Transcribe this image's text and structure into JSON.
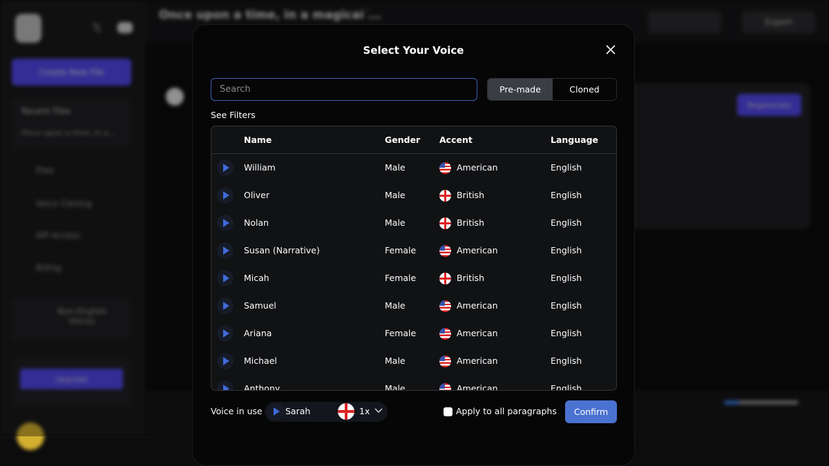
{
  "background": {
    "doc_title": "Once upon a time, in a magical ...",
    "create_new_file": "Create New File",
    "recent_files": "Recent Files",
    "recent_item": "Once upon a time, in a...",
    "nav": [
      "Files",
      "Voice Cloning",
      "API Access",
      "Billing"
    ],
    "non_english": "Non-English Voices",
    "upgrade": "Upgrade",
    "export": "Export",
    "regenerate": "Regenerate"
  },
  "modal": {
    "title": "Select Your Voice",
    "search_placeholder": "Search",
    "tabs": [
      {
        "label": "Pre-made",
        "active": true
      },
      {
        "label": "Cloned",
        "active": false
      }
    ],
    "see_filters": "See Filters",
    "columns": {
      "name": "Name",
      "gender": "Gender",
      "accent": "Accent",
      "language": "Language"
    },
    "voices": [
      {
        "name": "William",
        "gender": "Male",
        "accent": "American",
        "flag": "us",
        "language": "English"
      },
      {
        "name": "Oliver",
        "gender": "Male",
        "accent": "British",
        "flag": "uk",
        "language": "English"
      },
      {
        "name": "Nolan",
        "gender": "Male",
        "accent": "British",
        "flag": "uk",
        "language": "English"
      },
      {
        "name": "Susan (Narrative)",
        "gender": "Female",
        "accent": "American",
        "flag": "us",
        "language": "English"
      },
      {
        "name": "Micah",
        "gender": "Female",
        "accent": "British",
        "flag": "uk",
        "language": "English"
      },
      {
        "name": "Samuel",
        "gender": "Male",
        "accent": "American",
        "flag": "us",
        "language": "English"
      },
      {
        "name": "Ariana",
        "gender": "Female",
        "accent": "American",
        "flag": "us",
        "language": "English"
      },
      {
        "name": "Michael",
        "gender": "Male",
        "accent": "American",
        "flag": "us",
        "language": "English"
      },
      {
        "name": "Anthony",
        "gender": "Male",
        "accent": "American",
        "flag": "us",
        "language": "English"
      }
    ],
    "footer": {
      "voice_in_use_label": "Voice in use",
      "voice_in_use": "Sarah",
      "voice_flag": "uk",
      "speed": "1x",
      "apply_all_label": "Apply to all paragraphs",
      "apply_all_checked": false,
      "confirm": "Confirm"
    },
    "colors": {
      "accent": "#4a72d0",
      "play": "#3f6ad8",
      "brand": "#5046e5"
    }
  }
}
